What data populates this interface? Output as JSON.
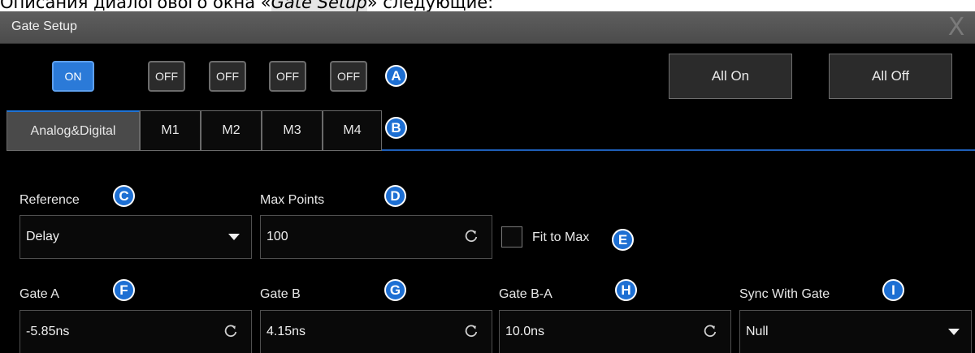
{
  "caption": {
    "before": "Описания диалогового окна «",
    "highlight": "Gate Setup",
    "after": "» следующие:"
  },
  "dialog": {
    "title": "Gate Setup",
    "close_label": "X",
    "toggles": [
      {
        "label": "ON",
        "state": "on"
      },
      {
        "label": "OFF",
        "state": "off"
      },
      {
        "label": "OFF",
        "state": "off"
      },
      {
        "label": "OFF",
        "state": "off"
      },
      {
        "label": "OFF",
        "state": "off"
      }
    ],
    "all_on_label": "All On",
    "all_off_label": "All Off",
    "tabs": [
      {
        "label": "Analog&Digital",
        "active": true
      },
      {
        "label": "M1",
        "active": false
      },
      {
        "label": "M2",
        "active": false
      },
      {
        "label": "M3",
        "active": false
      },
      {
        "label": "M4",
        "active": false
      }
    ],
    "reference": {
      "label": "Reference",
      "value": "Delay"
    },
    "max_points": {
      "label": "Max Points",
      "value": "100"
    },
    "fit_to_max": {
      "label": "Fit to Max",
      "checked": false
    },
    "gate_a": {
      "label": "Gate A",
      "value": "-5.85ns"
    },
    "gate_b": {
      "label": "Gate B",
      "value": "4.15ns"
    },
    "gate_ba": {
      "label": "Gate B-A",
      "value": "10.0ns"
    },
    "sync_with_gate": {
      "label": "Sync With Gate",
      "value": "Null"
    }
  },
  "markers": {
    "a": "A",
    "b": "B",
    "c": "C",
    "d": "D",
    "e": "E",
    "f": "F",
    "g": "G",
    "h": "H",
    "i": "I"
  },
  "colors": {
    "accent": "#2b7ad8",
    "marker": "#1d6fd3",
    "background": "#000000",
    "titlebar": "#555555"
  },
  "icons": {
    "refresh": "refresh-icon",
    "dropdown": "caret-down-icon",
    "close": "close-icon"
  }
}
